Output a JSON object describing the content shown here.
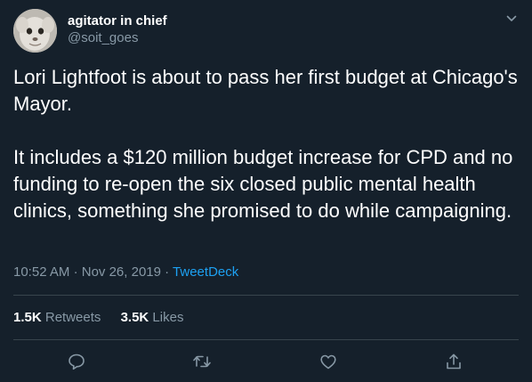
{
  "user": {
    "display_name": "agitator in chief",
    "handle": "@soit_goes",
    "avatar_icon": "avatar-face-icon"
  },
  "tweet": {
    "paragraphs": [
      "Lori Lightfoot is about to pass her first budget at Chicago's Mayor.",
      "It includes a $120 million budget increase for CPD and no funding to re-open the six closed public mental health clinics, something she promised to do while campaigning."
    ],
    "time": "10:52 AM",
    "separator": "·",
    "date": "Nov 26, 2019",
    "source": "TweetDeck"
  },
  "stats": {
    "retweets_count": "1.5K",
    "retweets_label": "Retweets",
    "likes_count": "3.5K",
    "likes_label": "Likes"
  },
  "actions": [
    "reply-icon",
    "retweet-icon",
    "like-icon",
    "share-icon"
  ],
  "colors": {
    "background": "#15202b",
    "text": "#ffffff",
    "muted": "#8899a6",
    "accent": "#1da1f2",
    "divider": "#38444d"
  }
}
